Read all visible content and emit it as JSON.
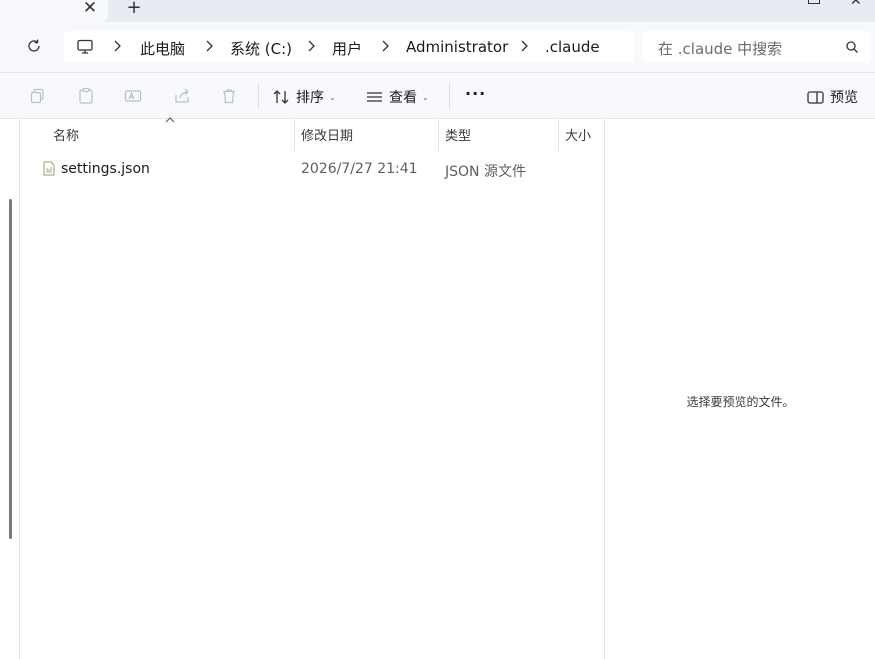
{
  "tabs": {
    "close_glyph": "✕",
    "new_glyph": "+"
  },
  "breadcrumb": {
    "items": [
      "此电脑",
      "系统 (C:)",
      "用户",
      "Administrator",
      ".claude"
    ]
  },
  "search": {
    "placeholder": "在 .claude 中搜索"
  },
  "toolbar": {
    "sort_label": "排序",
    "view_label": "查看",
    "more_label": "···",
    "preview_label": "预览"
  },
  "columns": {
    "name": "名称",
    "modified": "修改日期",
    "type": "类型",
    "size": "大小"
  },
  "files": [
    {
      "name": "settings.json",
      "modified": "2026/7/27 21:41",
      "type": "JSON 源文件",
      "size": ""
    }
  ],
  "preview_pane": {
    "message": "选择要预览的文件。"
  },
  "colors": {
    "accent": "#0067c0",
    "chrome": "#f8f9fc",
    "tabstrip": "#e7ebf2"
  }
}
